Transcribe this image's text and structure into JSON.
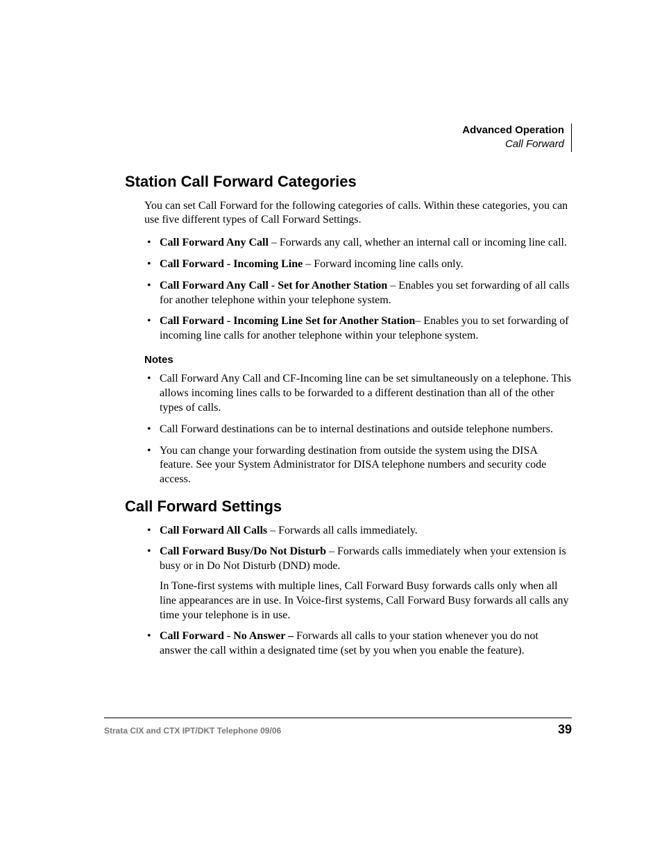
{
  "header": {
    "chapter": "Advanced Operation",
    "section": "Call Forward"
  },
  "sections": [
    {
      "title": "Station Call Forward Categories",
      "intro": "You can set Call Forward for the following categories of calls. Within these categories, you can use five different types of Call Forward Settings.",
      "items": [
        {
          "term": "Call Forward Any Call",
          "sep": " – ",
          "desc": "Forwards any call, whether an internal call or incoming line call."
        },
        {
          "term": "Call Forward - Incoming Line",
          "sep": " – ",
          "desc": "Forward incoming line calls only."
        },
        {
          "term": "Call Forward Any Call - Set for Another Station",
          "sep": " – ",
          "desc": "Enables you set forwarding of all calls for another telephone within your telephone system."
        },
        {
          "term": "Call Forward - Incoming Line Set for Another Station",
          "sep": "– ",
          "desc": "Enables you to set forwarding of incoming line calls for another telephone within your telephone system."
        }
      ],
      "notes_label": "Notes",
      "notes": [
        "Call Forward Any Call and CF-Incoming line can be set simultaneously on a telephone. This allows incoming lines calls to be forwarded to a different destination than all of the other types of calls.",
        "Call Forward destinations can be to internal destinations and outside telephone numbers.",
        "You can change your forwarding destination from outside the system using the DISA feature. See your System Administrator for DISA telephone numbers and security code access."
      ]
    },
    {
      "title": "Call Forward Settings",
      "items": [
        {
          "term": "Call Forward All Calls",
          "sep": " – ",
          "desc": "Forwards all calls immediately."
        },
        {
          "term": "Call Forward Busy/Do Not Disturb",
          "sep": " – ",
          "desc": "Forwards calls immediately when your extension is busy or in Do Not Disturb (DND) mode.",
          "extra": "In Tone-first systems with multiple lines, Call Forward Busy forwards calls only when all line appearances are in use. In Voice-first systems, Call Forward Busy forwards all calls any time your telephone is in use."
        },
        {
          "term": "Call Forward - No Answer –",
          "sep": " ",
          "desc": "Forwards all calls to your station whenever you do not answer the call within a designated time (set by you when you enable the feature)."
        }
      ]
    }
  ],
  "footer": {
    "doc": "Strata CIX and CTX IPT/DKT Telephone     09/06",
    "page": "39"
  }
}
